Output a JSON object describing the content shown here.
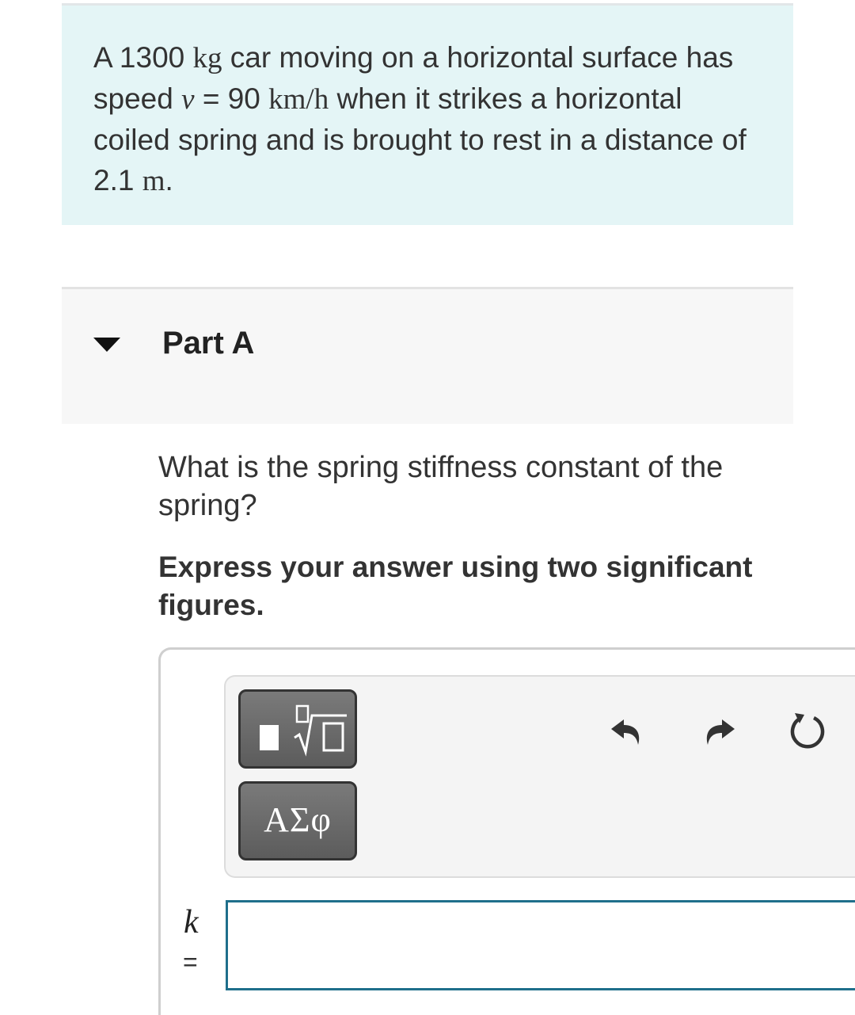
{
  "problem": {
    "prefix": "A 1300",
    "mass_unit": "kg",
    "t1": "car moving on a horizontal surface has speed",
    "speed_var": "v",
    "eq": "= 90",
    "speed_unit": "km/h",
    "t2": "when it strikes a horizontal coiled spring and is brought to rest in a distance of 2.1",
    "dist_unit": "m",
    "end": "."
  },
  "part": {
    "title": "Part A",
    "question": "What is the spring stiffness constant of the spring?",
    "instruction": "Express your answer using two significant figures."
  },
  "toolbar": {
    "templates_icon": "templates-sqrt-icon",
    "symbols_label": "ΑΣφ",
    "undo_icon": "undo-icon",
    "redo_icon": "redo-icon",
    "reset_icon": "reset-icon"
  },
  "answer": {
    "variable": "k",
    "equals": "=",
    "value": ""
  },
  "colors": {
    "problem_bg": "#e4f5f6",
    "part_bg": "#f7f7f7",
    "button_bg": "#6b6b6b",
    "input_border": "#1f6f8b"
  }
}
